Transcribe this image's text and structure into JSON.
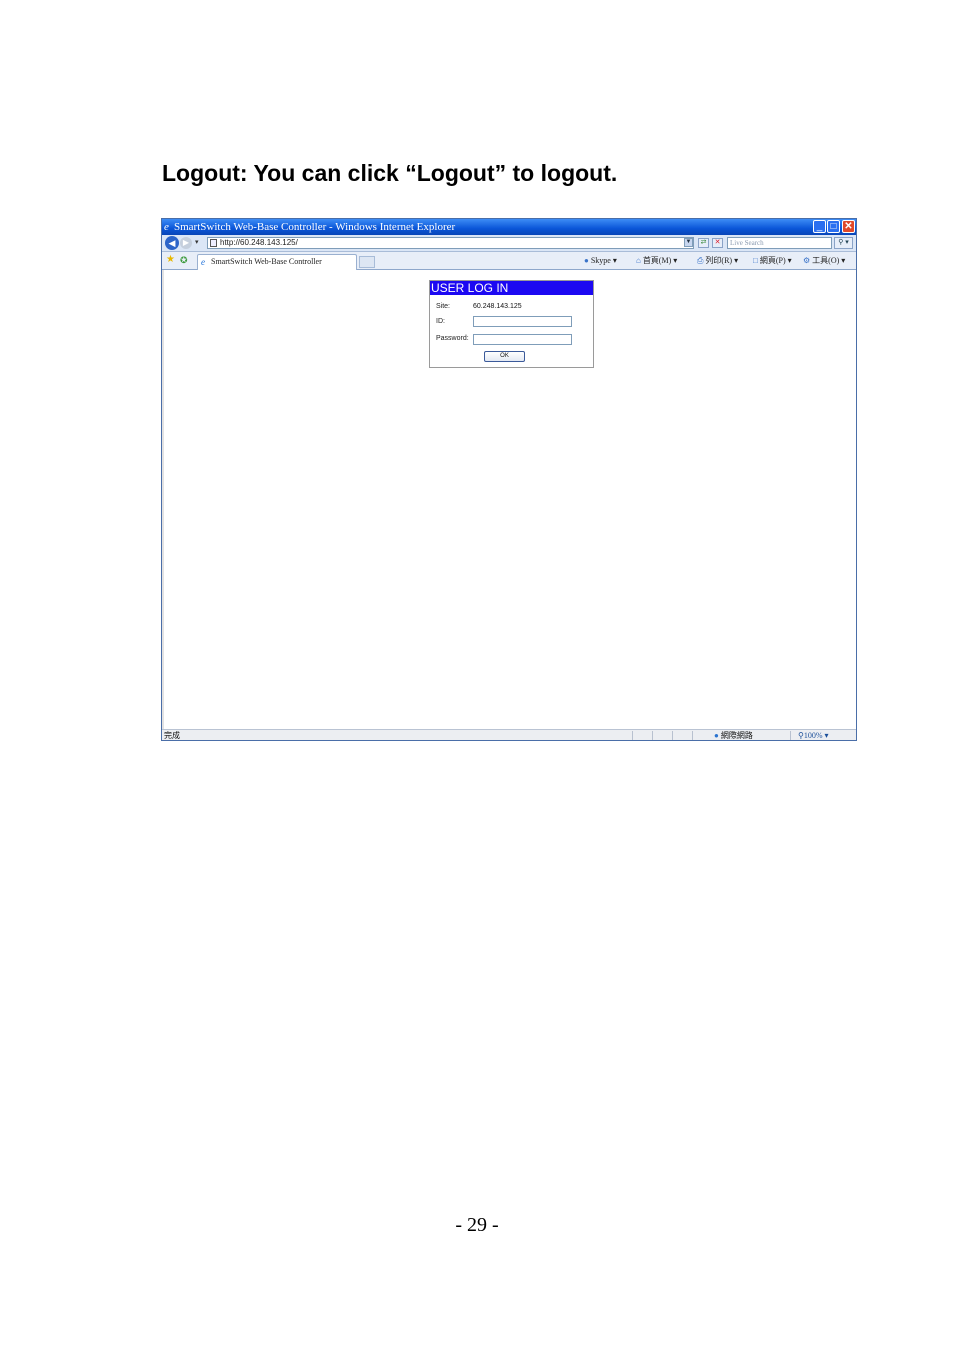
{
  "heading": "Logout: You can click “Logout” to logout.",
  "page_number": "- 29 -",
  "window": {
    "title": "SmartSwitch Web-Base Controller - Windows Internet Explorer",
    "url": "http://60.248.143.125/",
    "search_placeholder": "Live Search",
    "tab_label": "SmartSwitch Web-Base Controller",
    "commands": {
      "skype": "Skype",
      "home": "首頁(M)",
      "print": "列印(R)",
      "page": "網頁(P)",
      "tools": "工具(O)"
    },
    "status": {
      "text": "完成",
      "zone": "網際網路",
      "zoom": "100%"
    }
  },
  "login": {
    "title": "USER LOG IN",
    "site_label": "Site:",
    "site_value": "60.248.143.125",
    "id_label": "ID:",
    "id_value": "",
    "password_label": "Password:",
    "password_value": "",
    "ok_label": "OK"
  },
  "icons": [
    "ie-logo-icon",
    "minimize-icon",
    "maximize-icon",
    "close-icon",
    "back-arrow-icon",
    "forward-arrow-icon",
    "page-icon",
    "refresh-icon",
    "stop-icon",
    "search-icon",
    "favorites-star-icon",
    "add-favorites-icon",
    "home-icon",
    "printer-icon",
    "page-menu-icon",
    "gear-icon",
    "globe-icon",
    "zoom-icon"
  ],
  "colors": {
    "login_header": "#1c08f2",
    "titlebar": "#0a55d8"
  }
}
